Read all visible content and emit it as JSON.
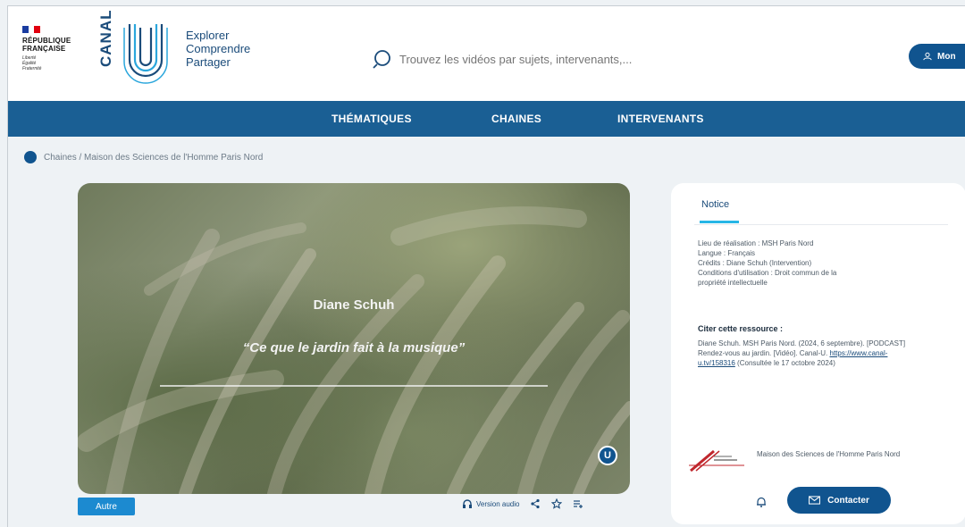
{
  "header": {
    "republique": {
      "title_lines": [
        "RÉPUBLIQUE",
        "FRANÇAISE"
      ],
      "motto_lines": [
        "Liberté",
        "Égalité",
        "Fraternité"
      ]
    },
    "brand": {
      "name": "CANAL",
      "tagline": [
        "Explorer",
        "Comprendre",
        "Partager"
      ]
    },
    "search": {
      "placeholder": "Trouvez les vidéos par sujets, intervenants,..."
    },
    "account_button": "Mon"
  },
  "nav": {
    "items": [
      "THÉMATIQUES",
      "CHAINES",
      "INTERVENANTS"
    ]
  },
  "breadcrumb": "Chaines / Maison des Sciences de l'Homme Paris Nord",
  "video": {
    "speaker": "Diane Schuh",
    "quote": "“Ce que le jardin fait à la musique”",
    "badge": "U"
  },
  "below_video": {
    "tag": "Autre",
    "audio_label": "Version audio"
  },
  "notice": {
    "tab": "Notice",
    "info_lines": [
      "Lieu de réalisation : MSH Paris Nord",
      "Langue : Français",
      "Crédits : Diane Schuh (Intervention)",
      "Conditions d'utilisation : Droit commun de la",
      "propriété intellectuelle"
    ],
    "cite_title": "Citer cette ressource :",
    "cite_text": "Diane Schuh. MSH Paris Nord. (2024, 6 septembre). [PODCAST] Rendez-vous au jardin. [Vidéo]. Canal-U.",
    "cite_link": "https://www.canal-u.tv/158316",
    "cite_after": "(Consultée le 17 octobre 2024)",
    "org_name": "Maison des Sciences de l'Homme Paris Nord",
    "contact": "Contacter"
  },
  "colors": {
    "primary": "#10548f",
    "nav": "#1a5f94",
    "accent": "#27b6e6",
    "tag": "#1c8ad0"
  }
}
